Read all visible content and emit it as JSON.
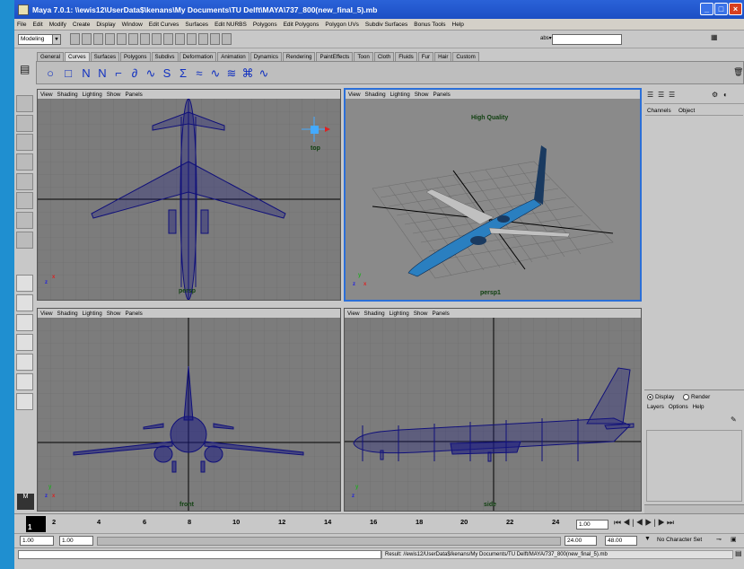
{
  "window": {
    "title": "Maya 7.0.1: \\\\ewis12\\UserData$\\kenans\\My Documents\\TU Delft\\MAYA\\737_800(new_final_5).mb",
    "controls": [
      "_",
      "□",
      "×"
    ]
  },
  "menubar": [
    "File",
    "Edit",
    "Modify",
    "Create",
    "Display",
    "Window",
    "Edit Curves",
    "Surfaces",
    "Edit NURBS",
    "Polygons",
    "Edit Polygons",
    "Polygon UVs",
    "Subdiv Surfaces",
    "Bonus Tools",
    "Help"
  ],
  "statusline": {
    "mode": "Modeling",
    "input_label": "abs▾",
    "input_value": ""
  },
  "shelf": {
    "tabs": [
      "General",
      "Curves",
      "Surfaces",
      "Polygons",
      "Subdivs",
      "Deformation",
      "Animation",
      "Dynamics",
      "Rendering",
      "PaintEffects",
      "Toon",
      "Cloth",
      "Fluids",
      "Fur",
      "Hair",
      "Custom"
    ],
    "active_tab": "Curves"
  },
  "viewports": {
    "menu": [
      "View",
      "Shading",
      "Lighting",
      "Show",
      "Panels"
    ],
    "top_left": {
      "label": "persp",
      "cube_label": "top"
    },
    "top_right": {
      "label": "persp1",
      "quality": "High Quality"
    },
    "bottom_left": {
      "label": "front"
    },
    "bottom_right": {
      "label": "side"
    },
    "axes": {
      "x": "x",
      "y": "y",
      "z": "z"
    }
  },
  "channelbox": {
    "tabs": [
      "Channels",
      "Object"
    ]
  },
  "layers": {
    "display": "Display",
    "render": "Render",
    "menu": [
      "Layers",
      "Options",
      "Help"
    ]
  },
  "timeslider": {
    "current": "1",
    "ticks": [
      "2",
      "4",
      "6",
      "8",
      "10",
      "12",
      "14",
      "16",
      "18",
      "20",
      "22",
      "24"
    ],
    "current_time": "1.00"
  },
  "range": {
    "start": "1.00",
    "anim_start": "1.00",
    "end": "24.00",
    "anim_end": "48.00",
    "character_set": "No Character Set"
  },
  "result": "Result: //ewis12/UserData$/kenans/My Documents/TU Delft/MAYA/737_800(new_final_5).mb",
  "colors": {
    "accent": "#2b6fd8",
    "viewport_bg": "#7c7c7c",
    "wire": "#10107a",
    "model_blue": "#2a7fc0"
  }
}
